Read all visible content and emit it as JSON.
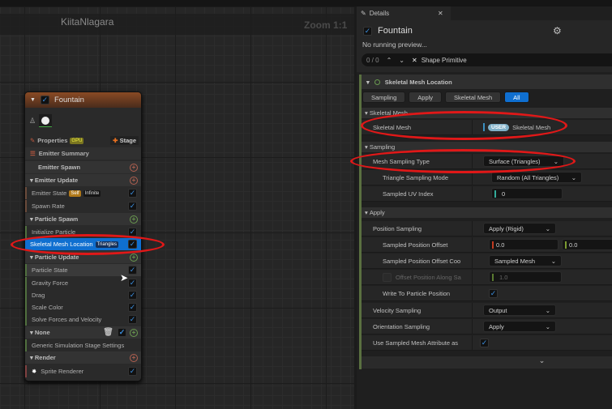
{
  "canvas": {
    "title": "KiitaNlagara",
    "zoom": "Zoom 1:1"
  },
  "node": {
    "title": "Fountain",
    "properties": "Properties",
    "gpu_tag": "GPU",
    "stage": "Stage",
    "rows": {
      "summary": "Emitter Summary",
      "emitter_spawn": "Emitter Spawn",
      "emitter_update": "Emitter Update",
      "emitter_state": "Emitter State",
      "self_tag": "Self",
      "infinite_tag": "Infinite",
      "spawn_rate": "Spawn Rate",
      "particle_spawn": "Particle Spawn",
      "init_particle": "Initialize Particle",
      "skel_loc": "Skeletal Mesh Location",
      "triangles_tag": "Triangles",
      "particle_update": "Particle Update",
      "particle_state": "Particle State",
      "gravity": "Gravity Force",
      "drag": "Drag",
      "scale_color": "Scale Color",
      "solve": "Solve Forces and Velocity",
      "none": "None",
      "generic": "Generic Simulation Stage Settings",
      "render": "Render",
      "sprite": "Sprite Renderer"
    }
  },
  "details": {
    "tab": "Details",
    "title": "Fountain",
    "preview": "No running preview...",
    "search_count": "0 / 0",
    "search_value": "Shape Primitive",
    "module": "Skeletal Mesh Location",
    "filters": [
      "Sampling",
      "Apply",
      "Skeletal Mesh",
      "All"
    ],
    "cat_skel": "Skeletal Mesh",
    "skel_label": "Skeletal Mesh",
    "user_badge": "USER",
    "skel_value": "Skeletal Mesh",
    "cat_sampling": "Sampling",
    "mst_label": "Mesh Sampling Type",
    "mst_value": "Surface (Triangles)",
    "tsm_label": "Triangle Sampling Mode",
    "tsm_value": "Random (All Triangles)",
    "uv_label": "Sampled UV Index",
    "uv_value": "0",
    "cat_apply": "Apply",
    "ps_label": "Position Sampling",
    "ps_value": "Apply (Rigid)",
    "spo_label": "Sampled Position Offset",
    "spo_x": "0.0",
    "spo_y": "0.0",
    "spoc_label": "Sampled Position Offset Coo",
    "spoc_value": "Sampled Mesh",
    "opa_label": "Offset Position Along Sa",
    "opa_value": "1.0",
    "wtp_label": "Write To Particle Position",
    "vs_label": "Velocity Sampling",
    "vs_value": "Output",
    "os_label": "Orientation Sampling",
    "os_value": "Apply",
    "usm_label": "Use Sampled Mesh Attribute as"
  }
}
